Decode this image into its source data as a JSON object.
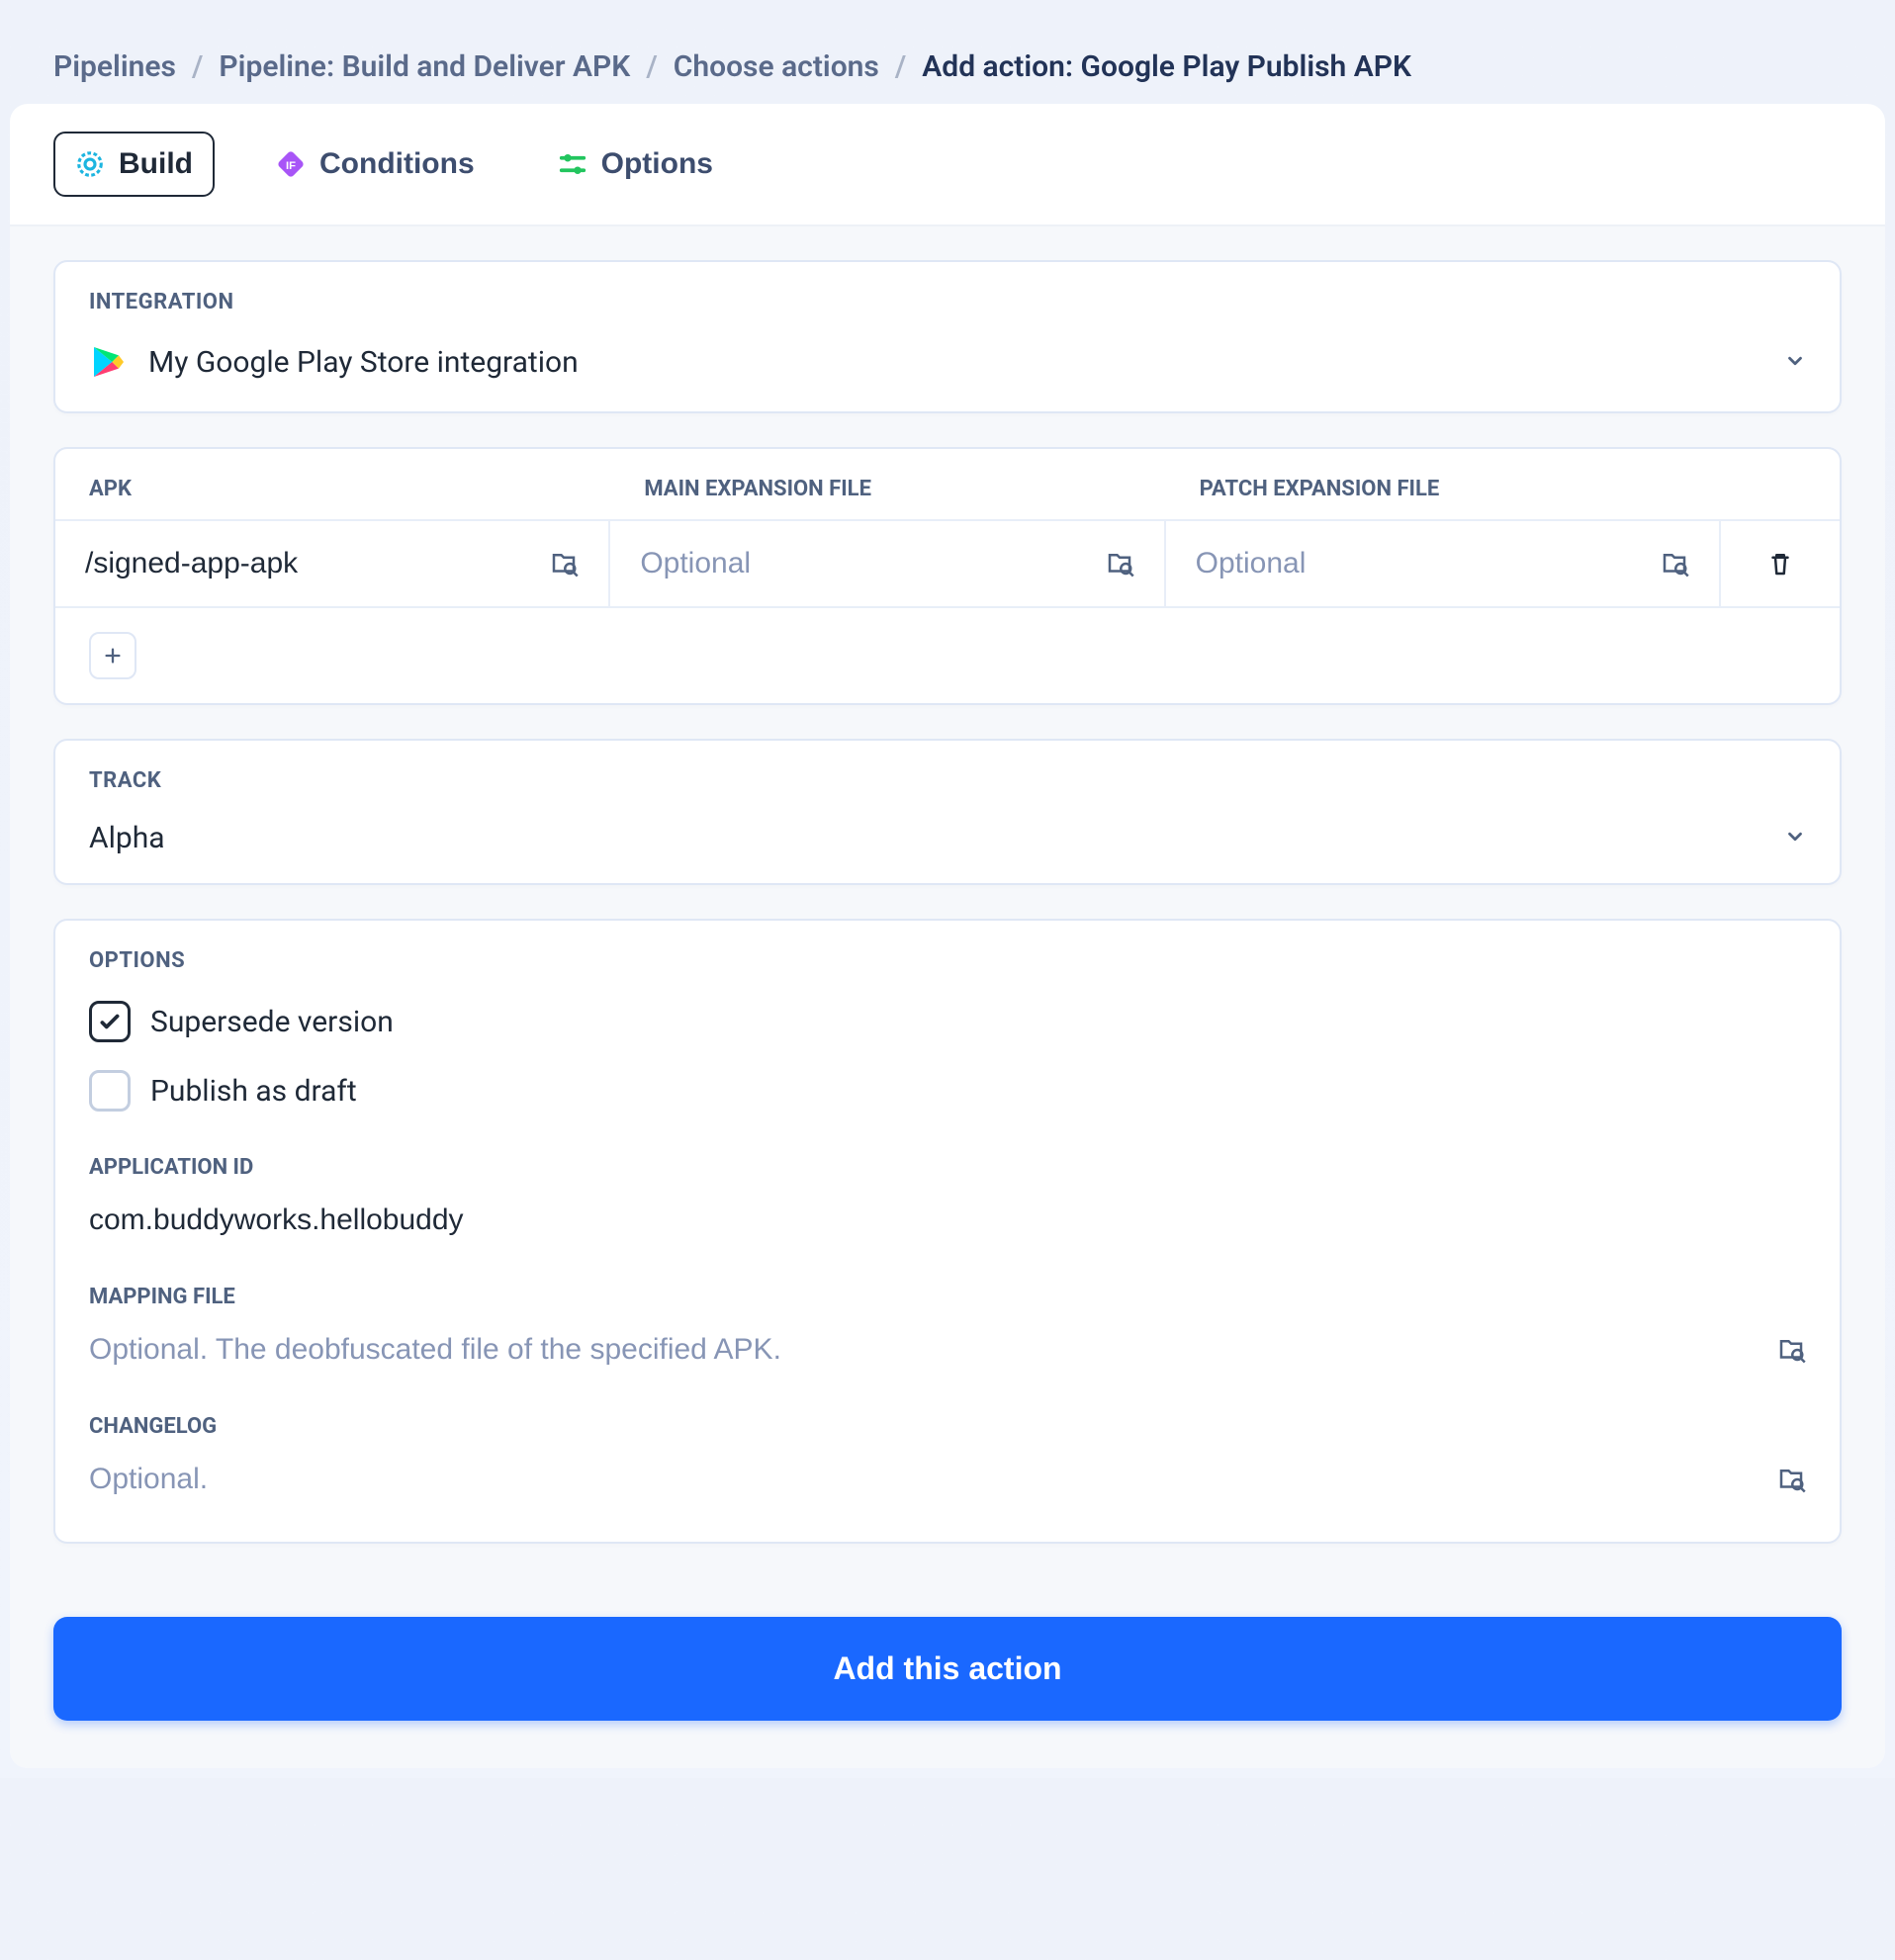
{
  "breadcrumb": {
    "items": [
      "Pipelines",
      "Pipeline: Build and Deliver APK",
      "Choose actions"
    ],
    "current": "Add action: Google Play Publish APK"
  },
  "tabs": {
    "build": "Build",
    "conditions": "Conditions",
    "options": "Options"
  },
  "integration": {
    "label": "INTEGRATION",
    "value": "My Google Play Store integration"
  },
  "apk": {
    "headers": {
      "apk": "APK",
      "main": "MAIN EXPANSION FILE",
      "patch": "PATCH EXPANSION FILE"
    },
    "row": {
      "apk_value": "/signed-app-apk",
      "main_placeholder": "Optional",
      "patch_placeholder": "Optional"
    }
  },
  "track": {
    "label": "TRACK",
    "value": "Alpha"
  },
  "options": {
    "label": "OPTIONS",
    "supersede": "Supersede version",
    "draft": "Publish as draft",
    "app_id_label": "APPLICATION ID",
    "app_id_value": "com.buddyworks.hellobuddy",
    "mapping_label": "MAPPING FILE",
    "mapping_placeholder": "Optional. The deobfuscated file of the specified APK.",
    "changelog_label": "CHANGELOG",
    "changelog_placeholder": "Optional."
  },
  "submit": "Add this action"
}
